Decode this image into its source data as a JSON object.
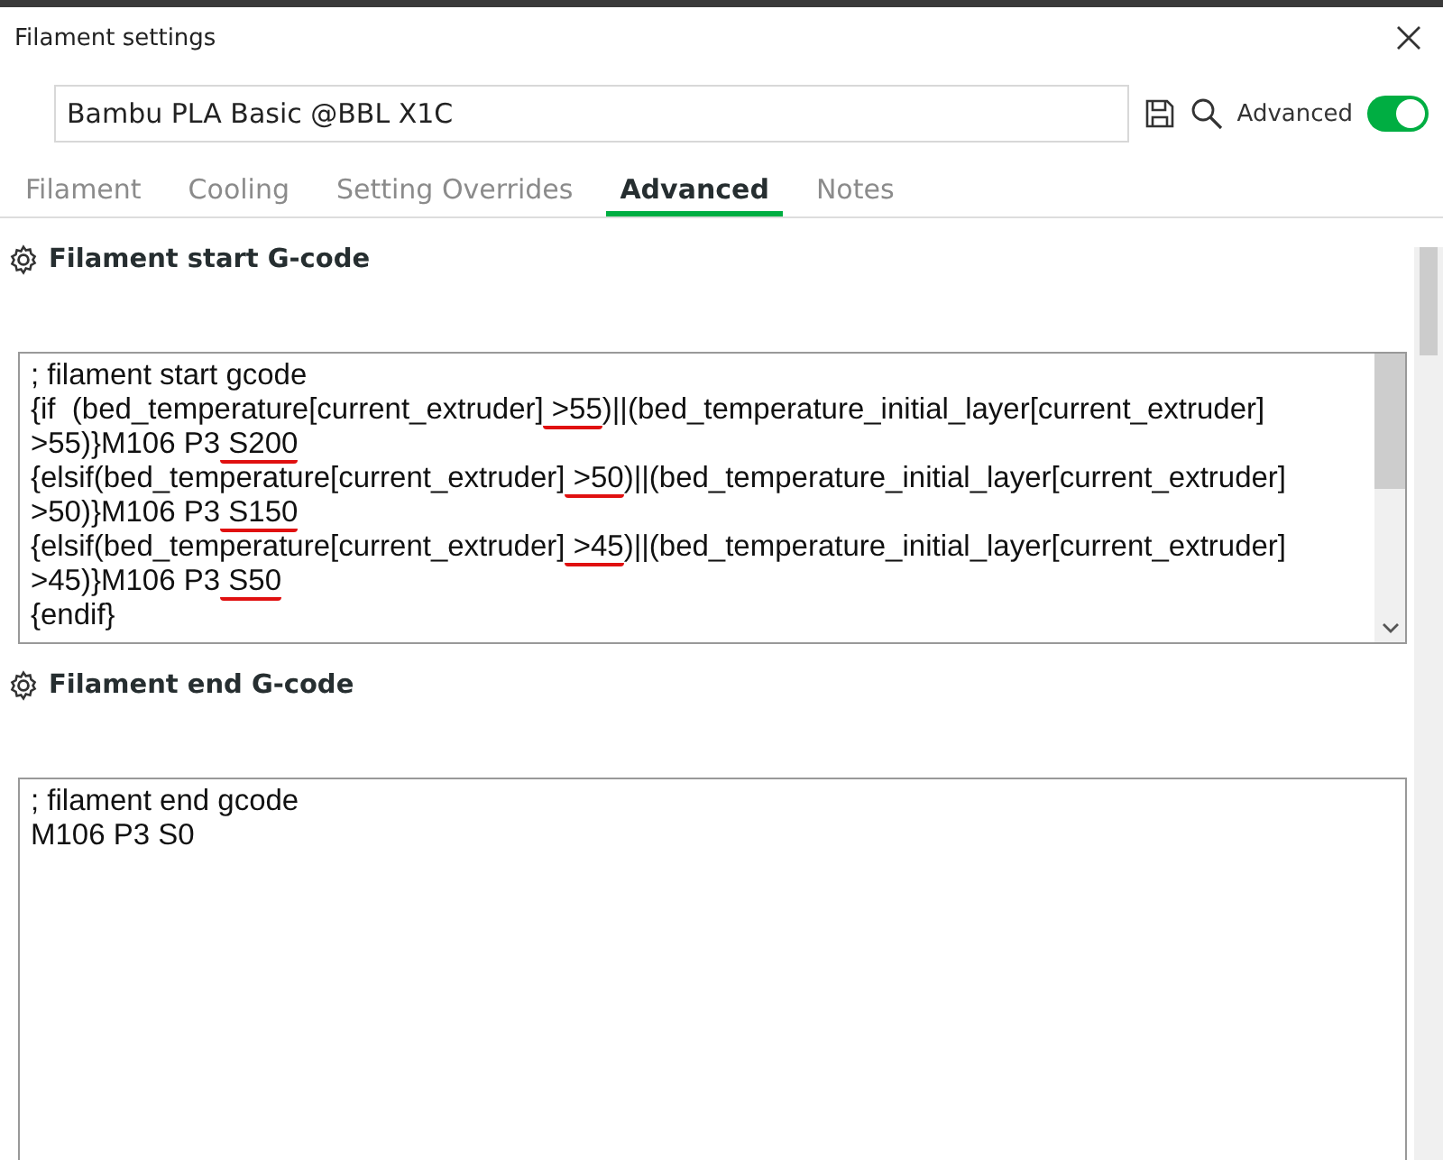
{
  "window": {
    "title": "Filament settings"
  },
  "preset": {
    "value": "Bambu PLA Basic @BBL X1C"
  },
  "advanced_toggle": {
    "label": "Advanced",
    "on": true
  },
  "tabs": [
    {
      "label": "Filament",
      "selected": false
    },
    {
      "label": "Cooling",
      "selected": false
    },
    {
      "label": "Setting Overrides",
      "selected": false
    },
    {
      "label": "Advanced",
      "selected": true
    },
    {
      "label": "Notes",
      "selected": false
    }
  ],
  "sections": [
    {
      "title": "Filament start G-code",
      "lines": [
        [
          {
            "text": "; filament start gcode",
            "marked": false
          }
        ],
        [
          {
            "text": "{if  (bed_temperature[current_extruder]",
            "marked": false
          },
          {
            "text": " >55",
            "marked": true
          },
          {
            "text": ")||(bed_temperature_initial_layer[current_extruder]",
            "marked": false
          }
        ],
        [
          {
            "text": ">55)}M106 P3",
            "marked": false
          },
          {
            "text": " S200",
            "marked": true
          }
        ],
        [
          {
            "text": "{elsif(bed_temperature[current_extruder]",
            "marked": false
          },
          {
            "text": " >50",
            "marked": true
          },
          {
            "text": ")||(bed_temperature_initial_layer[current_extruder]",
            "marked": false
          }
        ],
        [
          {
            "text": ">50)}M106 P3",
            "marked": false
          },
          {
            "text": " S150",
            "marked": true
          }
        ],
        [
          {
            "text": "{elsif(bed_temperature[current_extruder]",
            "marked": false
          },
          {
            "text": " >45",
            "marked": true
          },
          {
            "text": ")||(bed_temperature_initial_layer[current_extruder]",
            "marked": false
          }
        ],
        [
          {
            "text": ">45)}M106 P3",
            "marked": false
          },
          {
            "text": " S50",
            "marked": true
          }
        ],
        [
          {
            "text": "{endif}",
            "marked": false
          }
        ]
      ],
      "scroll": true
    },
    {
      "title": "Filament end G-code",
      "lines": [
        [
          {
            "text": "; filament end gcode",
            "marked": false
          }
        ],
        [
          {
            "text": "M106 P3 S0",
            "marked": false
          }
        ]
      ],
      "scroll": false
    }
  ]
}
